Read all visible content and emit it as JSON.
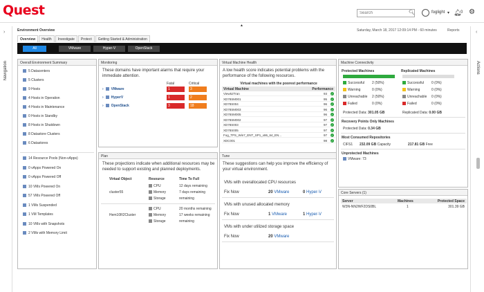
{
  "app": {
    "logo": "Quest",
    "search_placeholder": "Search",
    "user": "foglight",
    "notif_count": "0"
  },
  "nav": {
    "left": "Navigation",
    "right": "Actions"
  },
  "overview": {
    "title": "Environment Overview",
    "date": "Saturday, March 18, 2017 12:09:14 PM - 60 minutes",
    "reports": "Reports",
    "tabs": [
      "Overview",
      "Health",
      "Investigate",
      "Protect",
      "Getting Started & Administration"
    ],
    "filters": [
      "All",
      "VMware",
      "Hyper-V",
      "OpenStack"
    ]
  },
  "summary": {
    "title": "Overall Environment Summary",
    "group1": [
      "5 Datacenters",
      "5 Clusters",
      "9 Hosts",
      "4 Hosts in Operation",
      "4 Hosts in Maintenance",
      "0 Hosts in Standby",
      "8 Hosts in Shutdown",
      "8 Datastore Clusters",
      "6 Datastores"
    ],
    "group2": [
      "14 Resource Pools (Non-vApps)",
      "0 vApps Powered On",
      "0 vApps Powered Off",
      "10 VMs Powered On",
      "57 VMs Powered Off",
      "1 VMs Suspended",
      "1 VM Templates",
      "10 VMs with Snapshots",
      "2 VMs with Memory Limit"
    ]
  },
  "monitoring": {
    "title": "Monitoring",
    "desc": "These domains have important alarms that require your immediate attention.",
    "col_fatal": "Fatal",
    "col_critical": "Critical",
    "rows": [
      {
        "name": "VMware",
        "fatal": "1",
        "critical": "3"
      },
      {
        "name": "HyperV",
        "fatal": "1",
        "critical": "2"
      },
      {
        "name": "OpenStack",
        "fatal": "3",
        "critical": "18"
      }
    ]
  },
  "vmhealth": {
    "title": "Virtual Machine Health",
    "desc": "A low health score indicates potential problems with the performance of the following resources.",
    "subtitle": "Virtual machines with the poorest performance",
    "col_vm": "Virtual Machine",
    "col_perf": "Performance",
    "rows": [
      {
        "name": "View52Tran",
        "v": "93"
      },
      {
        "name": "XD78SM001",
        "v": "95"
      },
      {
        "name": "XD78S004",
        "v": "96"
      },
      {
        "name": "XD78SM003",
        "v": "96"
      },
      {
        "name": "XD78SM005",
        "v": "96"
      },
      {
        "name": "XD78SM002",
        "v": "97"
      },
      {
        "name": "XD78S003",
        "v": "97"
      },
      {
        "name": "XD78S005",
        "v": "97"
      },
      {
        "name": "Fog_TPS_Win7_ENT_SP1_x86_64_EN...",
        "v": "97"
      },
      {
        "name": "XDC001",
        "v": "98"
      }
    ]
  },
  "machine": {
    "title": "Machine Connectivity",
    "protected_h": "Protected Machines",
    "replicated_h": "Replicated Machines",
    "protected": [
      {
        "label": "Successful",
        "v": "2 (50%)",
        "color": "#2eaa3e"
      },
      {
        "label": "Warning",
        "v": "0 (0%)",
        "color": "#f2c01c"
      },
      {
        "label": "Unreachable",
        "v": "2 (50%)",
        "color": "#888888"
      },
      {
        "label": "Failed",
        "v": "0 (0%)",
        "color": "#d92a2a"
      }
    ],
    "replicated": [
      {
        "label": "Successful",
        "v": "0 (0%)",
        "color": "#2eaa3e"
      },
      {
        "label": "Warning",
        "v": "0 (0%)",
        "color": "#f2c01c"
      },
      {
        "label": "Unreachable",
        "v": "0 (0%)",
        "color": "#888888"
      },
      {
        "label": "Failed",
        "v": "0 (0%)",
        "color": "#d92a2a"
      }
    ],
    "protected_data_label": "Protected Data:",
    "protected_data": "301.05 GB",
    "replicated_data_label": "Replicated Data:",
    "replicated_data": "0.00 GB",
    "rpo_h": "Recovery Points Only Machines",
    "rpo_label": "Protected Data:",
    "rpo_data": "0.34 GB",
    "mcr_h": "Most Consumed Repositories",
    "mcr_name": "CIFS1",
    "mcr_cap": "232.09 GB",
    "mcr_cap_l": "Capacity",
    "mcr_free": "217.81 GB",
    "mcr_free_l": "Free",
    "unprot_h": "Unprotected Machines",
    "unprot": "VMware: 73"
  },
  "coreservers": {
    "title": "Core Servers (1)",
    "cols": [
      "Server",
      "Machines",
      "Protected Space"
    ],
    "row": [
      "W3N-NN2WF2DS0BL",
      "1",
      "301.39 GB"
    ]
  },
  "plan": {
    "title": "Plan",
    "desc": "These projections indicate when additional resources may be needed to support existing and planned deployments.",
    "cols": [
      "Virtual Object",
      "Resource",
      "Time To Full"
    ],
    "objects": [
      {
        "name": "cluster55",
        "res": [
          {
            "r": "CPU",
            "t": "12 days",
            "u": "remaining"
          },
          {
            "r": "Memory",
            "t": "7 days",
            "u": "remaining"
          },
          {
            "r": "Storage",
            "t": "",
            "u": "remaining"
          }
        ]
      },
      {
        "name": "Hem10R2Cluster",
        "res": [
          {
            "r": "CPU",
            "t": "20 months",
            "u": "remaining"
          },
          {
            "r": "Memory",
            "t": "17 weeks",
            "u": "remaining"
          },
          {
            "r": "Storage",
            "t": "",
            "u": "remaining"
          }
        ]
      }
    ]
  },
  "tune": {
    "title": "Tune",
    "desc": "These suggestions can help you improve the efficiency of your virtual environment.",
    "sections": [
      {
        "h": "VMs with overallocated CPU resources",
        "fix": "Fix Now",
        "a": "20",
        "al": "VMware",
        "b": "0",
        "bl": "Hyper-V"
      },
      {
        "h": "VMs with unused allocated memory",
        "fix": "Fix Now",
        "a": "1",
        "al": "VMware",
        "b": "1",
        "bl": "Hyper-V"
      },
      {
        "h": "VMs with under utilized storage space",
        "fix": "Fix Now",
        "a": "20",
        "al": "VMware",
        "b": "",
        "bl": ""
      }
    ]
  }
}
